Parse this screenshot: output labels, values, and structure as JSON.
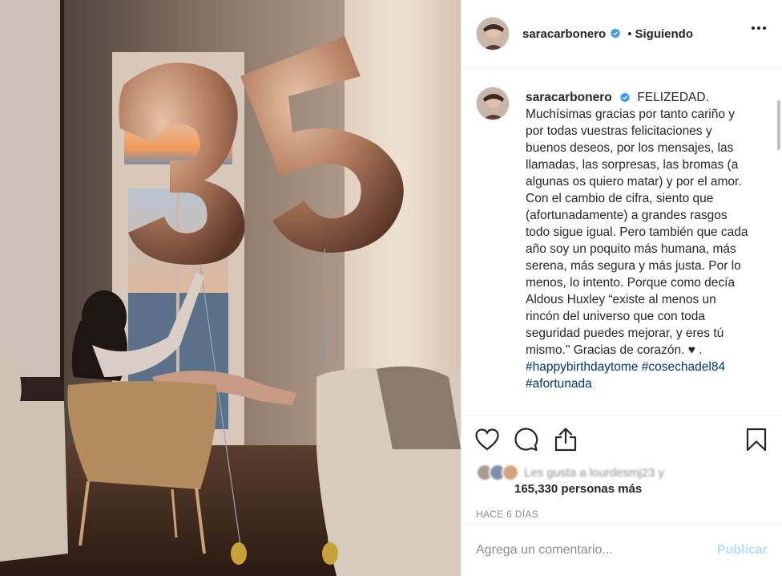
{
  "post": {
    "username": "saracarbonero",
    "separator": "•",
    "follow_status": "Siguiendo",
    "caption_title": "FELIZEDAD.",
    "caption_body": "Muchísimas gracias por tanto cariño y por todas vuestras felicitaciones y buenos deseos, por los mensajes, las llamadas, las sorpresas, las bromas (a algunas os quiero matar) y por el amor. Con el cambio de cifra, siento que (afortunadamente) a grandes rasgos todo sigue igual. Pero también que cada año soy un poquito más humana, más serena, más segura y más justa. Por lo menos, lo intento. Porque como decía Aldous Huxley “existe al menos un rincón del universo que con toda seguridad puedes mejorar, y eres tú mismo.\" Gracias de corazón. ♥ .",
    "hashtags": [
      "#happybirthdaytome",
      "#cosechadel84",
      "#afortunada"
    ],
    "likes_blurred": "Les gusta a lourdesmj23 y",
    "likes_count": "165,330 personas más",
    "time_ago": "HACE 6 DÍAS",
    "comment_placeholder": "Agrega un comentario...",
    "publish_label": "Publicar",
    "photo_numbers": "35"
  },
  "colors": {
    "verified": "#3897f0",
    "hashtag": "#00376b",
    "publish_disabled": "#b2dffc",
    "balloon": "#b07a5e"
  },
  "icons": {
    "more": "more-options-icon",
    "like": "heart-icon",
    "comment": "comment-icon",
    "share": "share-icon",
    "save": "bookmark-icon",
    "verified": "verified-badge-icon"
  }
}
